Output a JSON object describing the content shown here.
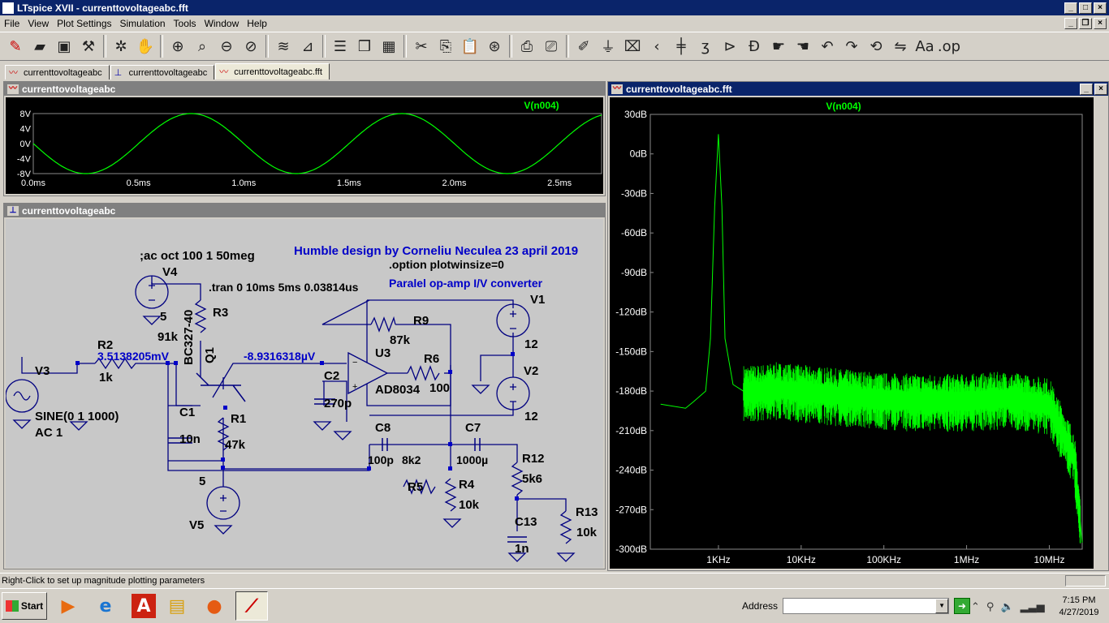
{
  "app": {
    "title": "LTspice XVII - currenttovoltageabc.fft",
    "menu": [
      "File",
      "View",
      "Plot Settings",
      "Simulation",
      "Tools",
      "Window",
      "Help"
    ]
  },
  "toolbar": {
    "icons": [
      "new-schematic",
      "open",
      "save",
      "control-panel",
      "run",
      "halt",
      "zoom-in",
      "zoom-pan",
      "zoom-out",
      "zoom-fit",
      "autorange",
      "plot-edit",
      "tile-horizontal",
      "cascade",
      "tile",
      "cut",
      "copy",
      "paste",
      "find",
      "print",
      "print-setup",
      "draw-wire",
      "ground",
      "label-net",
      "component",
      "resistor",
      "capacitor",
      "inductor",
      "diode",
      "component-library",
      "move",
      "drag",
      "undo",
      "redo",
      "rotate",
      "mirror",
      "text",
      "spice-directive"
    ]
  },
  "tabs": [
    {
      "label": "currenttovoltageabc",
      "icon": "waveform-icon"
    },
    {
      "label": "currenttovoltageabc",
      "icon": "schematic-icon"
    },
    {
      "label": "currenttovoltageabc.fft",
      "icon": "waveform-icon"
    }
  ],
  "time_window": {
    "title": "currenttovoltageabc",
    "trace_label": "V(n004)",
    "trace_color": "#00ff00",
    "chart_data": {
      "type": "line",
      "title": "V(n004)",
      "x_tick_labels": [
        "0.0ms",
        "0.5ms",
        "1.0ms",
        "1.5ms",
        "2.0ms",
        "2.5ms"
      ],
      "y_tick_labels": [
        "8V",
        "4V",
        "0V",
        "-4V",
        "-8V"
      ],
      "xlim": [
        0,
        2.7
      ],
      "ylim": [
        -8,
        8
      ],
      "series": [
        {
          "name": "V(n004)",
          "function": "sine",
          "amplitude_V": 8,
          "frequency_Hz": 1000,
          "phase_deg": 180
        }
      ]
    }
  },
  "fft_window": {
    "title": "currenttovoltageabc.fft",
    "trace_label": "V(n004)",
    "trace_color": "#00ff00",
    "chart_data": {
      "type": "line",
      "title": "V(n004)",
      "x_scale": "log",
      "y_tick_labels": [
        "30dB",
        "0dB",
        "-30dB",
        "-60dB",
        "-90dB",
        "-120dB",
        "-150dB",
        "-180dB",
        "-210dB",
        "-240dB",
        "-270dB",
        "-300dB"
      ],
      "x_tick_labels": [
        "1KHz",
        "10KHz",
        "100KHz",
        "1MHz",
        "10MHz"
      ],
      "ylim": [
        -300,
        30
      ],
      "series": [
        {
          "name": "V(n004)",
          "x_Hz": [
            200,
            400,
            500,
            700,
            800,
            900,
            1000,
            1100,
            1200,
            1500,
            2000,
            3000,
            5000,
            10000,
            30000,
            100000,
            300000,
            1000000,
            3000000,
            10000000,
            20000000,
            25000000
          ],
          "y_dB": [
            -190,
            -193,
            -188,
            -180,
            -140,
            -40,
            15,
            -40,
            -140,
            -175,
            -180,
            -180,
            -178,
            -180,
            -183,
            -186,
            -187,
            -187,
            -185,
            -190,
            -230,
            -295
          ]
        }
      ]
    }
  },
  "schematic": {
    "title": "currenttovoltageabc",
    "texts": {
      "ac_directive": ";ac oct 100 1 50meg",
      "heading": "Humble design by Corneliu Neculea 23 april 2019",
      "option": ".option plotwinsize=0",
      "tran": ".tran 0 10ms 5ms 0.03814us",
      "subtitle": "Paralel op-amp I/V converter",
      "probe_v1": "3.5138205mV",
      "probe_v2": "-8.9316318µV"
    },
    "components": {
      "V4": "V4",
      "V4_val": "5",
      "V3": "V3",
      "V3_val1": "SINE(0 1 1000)",
      "V3_val2": "AC 1",
      "R2": "R2",
      "R2_val": "1k",
      "R3": "R3",
      "R3_val": "91k",
      "Q1": "Q1",
      "Q1_val": "BC327-40",
      "C1": "C1",
      "C1_val": "10n",
      "R1": "R1",
      "R1_val": "47k",
      "V5": "V5",
      "V5_val": "5",
      "U3": "U3",
      "U3_val": "AD8034",
      "R9": "R9",
      "R9_val": "87k",
      "R6": "R6",
      "R6_val": "100",
      "C2": "C2",
      "C2_val": "270p",
      "C8": "C8",
      "C8_val": "100p",
      "R5": "R5",
      "R5_val": "8k2",
      "R4": "R4",
      "R4_val": "10k",
      "C7": "C7",
      "C7_val": "1000µ",
      "R12": "R12",
      "R12_val": "5k6",
      "C13": "C13",
      "C13_val": "1n",
      "R13": "R13",
      "R13_val": "10k",
      "V1": "V1",
      "V1_val": "12",
      "V2": "V2",
      "V2_val": "12"
    }
  },
  "status": {
    "text": "Right-Click to set up magnitude plotting parameters"
  },
  "taskbar": {
    "start": "Start",
    "address_label": "Address",
    "address_value": "",
    "time": "7:15 PM",
    "date": "4/27/2019",
    "apps": [
      "media-player",
      "internet-explorer",
      "acrobat",
      "file-explorer",
      "firefox",
      "ltspice"
    ]
  }
}
